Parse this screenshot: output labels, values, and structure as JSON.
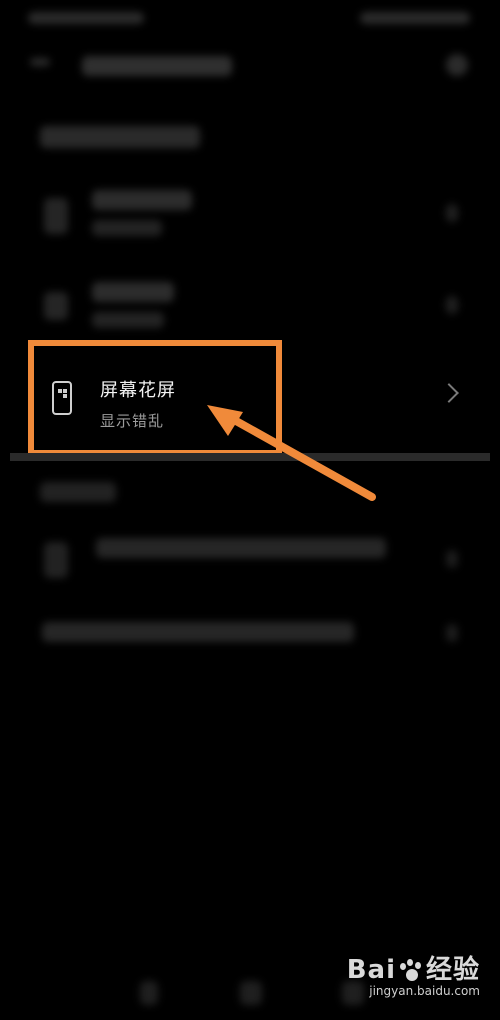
{
  "highlighted_item": {
    "title": "屏幕花屏",
    "subtitle": "显示错乱"
  },
  "watermark": {
    "brand_left": "Bai",
    "brand_right": "经验",
    "url": "jingyan.baidu.com"
  },
  "colors": {
    "highlight": "#f08a3a",
    "background": "#000000"
  },
  "icons": [
    "back-arrow-icon",
    "search-icon",
    "phone-icon",
    "chevron-right-icon",
    "paw-logo-icon"
  ]
}
